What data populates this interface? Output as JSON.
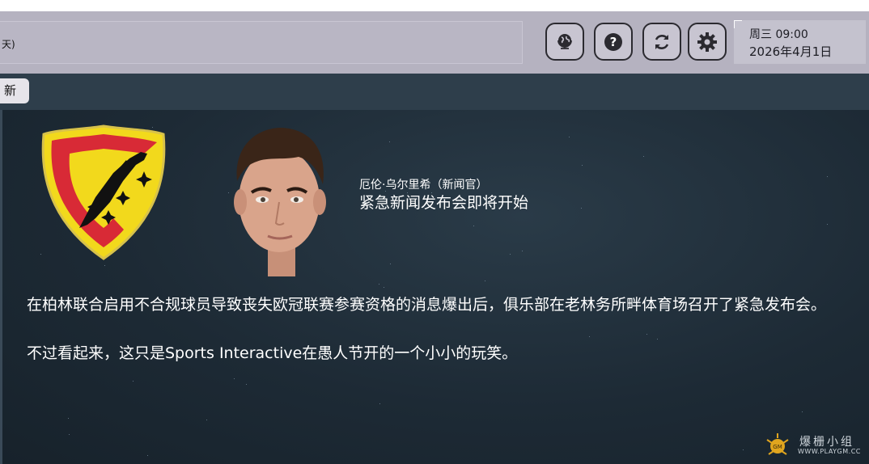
{
  "header": {
    "title_fragment": "天)",
    "buttons": [
      {
        "icon": "globe-icon"
      },
      {
        "icon": "help-icon"
      },
      {
        "icon": "refresh-icon"
      },
      {
        "icon": "gear-icon"
      }
    ],
    "date": {
      "day_time": "周三 09:00",
      "date": "2026年4月1日"
    }
  },
  "tabs": {
    "news_label": "新闻"
  },
  "article": {
    "speaker": "厄伦·乌尔里希（新闻官）",
    "headline": "紧急新闻发布会即将开始",
    "paragraph1": "在柏林联合启用不合规球员导致丧失欧冠联赛参赛资格的消息爆出后，俱乐部在老林务所畔体育场召开了紧急发布会。",
    "paragraph2": "不过看起来，这只是Sports Interactive在愚人节开的一个小小的玩笑。"
  },
  "crest": {
    "colors": {
      "red": "#d82a36",
      "yellow": "#f2d91c",
      "black": "#111111"
    }
  },
  "watermark": {
    "text": "爆栅小组",
    "url": "WWW.PLAYGM.CC"
  },
  "colors": {
    "header_bg": "#b5b2c0",
    "tabbar_bg": "#2e3e4b",
    "content_bg": "#1d2a35"
  }
}
